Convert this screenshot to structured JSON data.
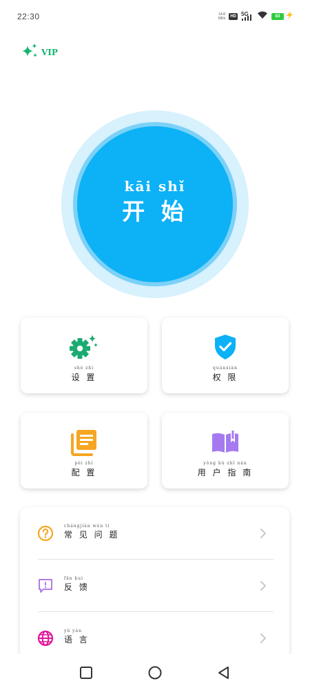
{
  "status_bar": {
    "time": "22:30",
    "net_speed_value": "14.8",
    "net_speed_unit": "KB/s",
    "hd": "HD",
    "network": "5G",
    "battery": "83"
  },
  "vip": {
    "label": "VIP",
    "icon": "sparkle-icon"
  },
  "start": {
    "pinyin": "kāi  shǐ",
    "label": "开 始"
  },
  "cards": {
    "settings": {
      "pinyin": "shè  zhì",
      "label": "设 置",
      "icon": "gear-sparkle-icon",
      "color": "#1aab73"
    },
    "permissions": {
      "pinyin": "quánxiàn",
      "label": "权 限",
      "icon": "shield-check-icon",
      "color": "#0cb1f6"
    },
    "config": {
      "pinyin": "pèi  zhì",
      "label": "配 置",
      "icon": "document-stack-icon",
      "color": "#f5a623"
    },
    "guide": {
      "pinyin": "yòng hù  zhǐ nán",
      "label": "用 户 指 南",
      "icon": "open-book-icon",
      "color": "#a57af0"
    }
  },
  "list": {
    "faq": {
      "pinyin": "chángjiàn wèn  tí",
      "label": "常 见 问 题",
      "icon": "question-circle-icon",
      "color": "#f5a623"
    },
    "feedback": {
      "pinyin": "fǎn  kuì",
      "label": "反 馈",
      "icon": "feedback-message-icon",
      "color": "#b07be8"
    },
    "language": {
      "pinyin": "yǔ  yán",
      "label": "语 言",
      "icon": "globe-icon",
      "color": "#e0149c"
    }
  },
  "nav": {
    "icons": [
      "recent-apps-icon",
      "home-icon",
      "back-icon"
    ]
  }
}
